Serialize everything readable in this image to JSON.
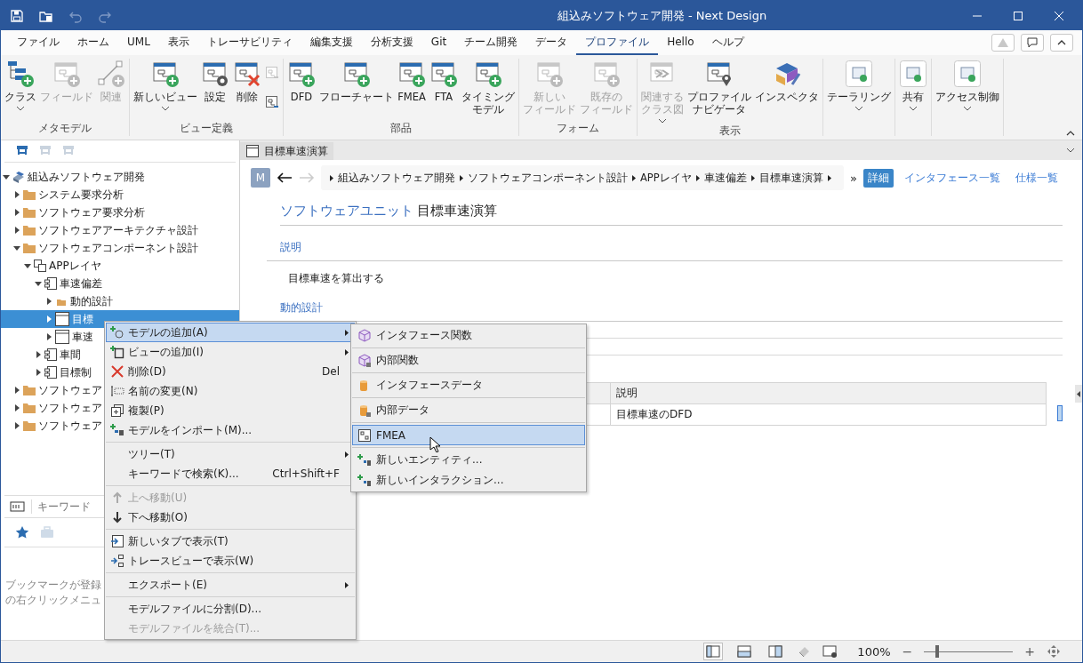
{
  "window": {
    "title": "組込みソフトウェア開発 - Next Design"
  },
  "menu_tabs": [
    {
      "label": "ファイル",
      "selected": false
    },
    {
      "label": "ホーム",
      "selected": false
    },
    {
      "label": "UML",
      "selected": false
    },
    {
      "label": "表示",
      "selected": false
    },
    {
      "label": "トレーサビリティ",
      "selected": false
    },
    {
      "label": "編集支援",
      "selected": false
    },
    {
      "label": "分析支援",
      "selected": false
    },
    {
      "label": "Git",
      "selected": false
    },
    {
      "label": "チーム開発",
      "selected": false
    },
    {
      "label": "データ",
      "selected": false
    },
    {
      "label": "プロファイル",
      "selected": true
    },
    {
      "label": "Hello",
      "selected": false
    },
    {
      "label": "ヘルプ",
      "selected": false
    }
  ],
  "ribbon": {
    "groups": [
      {
        "label": "メタモデル",
        "buttons": [
          {
            "lines": [
              "クラス"
            ],
            "dropdown": true,
            "disabled": false
          },
          {
            "lines": [
              "フィールド"
            ],
            "dropdown": false,
            "disabled": true
          },
          {
            "lines": [
              "関連"
            ],
            "dropdown": false,
            "disabled": true
          }
        ]
      },
      {
        "label": "ビュー定義",
        "buttons": [
          {
            "lines": [
              "新しいビュー"
            ],
            "dropdown": true,
            "disabled": false
          },
          {
            "lines": [
              "設定"
            ],
            "dropdown": false,
            "disabled": false
          },
          {
            "lines": [
              "削除"
            ],
            "dropdown": false,
            "disabled": false
          }
        ],
        "small_buttons": [
          {
            "disabled": true
          },
          {
            "disabled": false
          }
        ]
      },
      {
        "label": "部品",
        "buttons": [
          {
            "lines": [
              "DFD"
            ],
            "dropdown": false,
            "disabled": false
          },
          {
            "lines": [
              "フローチャート"
            ],
            "dropdown": false,
            "disabled": false
          },
          {
            "lines": [
              "FMEA"
            ],
            "dropdown": false,
            "disabled": false
          },
          {
            "lines": [
              "FTA"
            ],
            "dropdown": false,
            "disabled": false
          },
          {
            "lines": [
              "タイミング",
              "モデル"
            ],
            "dropdown": false,
            "disabled": false
          }
        ]
      },
      {
        "label": "フォーム",
        "buttons": [
          {
            "lines": [
              "新しい",
              "フィールド"
            ],
            "dropdown": false,
            "disabled": true
          },
          {
            "lines": [
              "既存の",
              "フィールド"
            ],
            "dropdown": false,
            "disabled": true
          }
        ]
      },
      {
        "label": "表示",
        "buttons": [
          {
            "lines": [
              "関連する",
              "クラス図"
            ],
            "dropdown": true,
            "disabled": true
          },
          {
            "lines": [
              "プロファイル",
              "ナビゲータ"
            ],
            "dropdown": false,
            "disabled": false
          },
          {
            "lines": [
              "インスペクタ"
            ],
            "dropdown": false,
            "disabled": false
          }
        ]
      },
      {
        "buttons": [
          {
            "lines": [
              "テーラリング"
            ],
            "dropdown": true,
            "disabled": false
          }
        ]
      },
      {
        "buttons": [
          {
            "lines": [
              "共有"
            ],
            "dropdown": true,
            "disabled": false
          }
        ]
      },
      {
        "buttons": [
          {
            "lines": [
              "アクセス制御"
            ],
            "dropdown": true,
            "disabled": false
          }
        ]
      }
    ]
  },
  "tree_toolbar": [
    {
      "disabled": false
    },
    {
      "disabled": true
    },
    {
      "disabled": true
    }
  ],
  "tree": {
    "items": [
      {
        "label": "組込みソフトウェア開発",
        "kind": "project",
        "expanded": true,
        "selected": false,
        "children": [
          {
            "label": "システム要求分析",
            "kind": "folder",
            "expanded": false,
            "selected": false
          },
          {
            "label": "ソフトウェア要求分析",
            "kind": "folder",
            "expanded": false,
            "selected": false
          },
          {
            "label": "ソフトウェアアーキテクチャ設計",
            "kind": "folder",
            "expanded": false,
            "selected": false
          },
          {
            "label": "ソフトウェアコンポーネント設計",
            "kind": "folder",
            "expanded": true,
            "selected": false,
            "children": [
              {
                "label": "APPレイヤ",
                "kind": "layer",
                "expanded": true,
                "selected": false,
                "children": [
                  {
                    "label": "車速偏差",
                    "kind": "component",
                    "expanded": true,
                    "selected": false,
                    "children": [
                      {
                        "label": "動的設計",
                        "kind": "subfolder",
                        "expanded": false,
                        "selected": false
                      },
                      {
                        "label": "目標",
                        "kind": "unit",
                        "expanded": false,
                        "selected": true
                      },
                      {
                        "label": "車速",
                        "kind": "unit",
                        "expanded": false,
                        "selected": false
                      }
                    ]
                  },
                  {
                    "label": "車間",
                    "kind": "component",
                    "expanded": false,
                    "selected": false
                  },
                  {
                    "label": "目標制",
                    "kind": "component",
                    "expanded": false,
                    "selected": false
                  }
                ]
              }
            ]
          },
          {
            "label": "ソフトウェア",
            "kind": "folder",
            "expanded": false,
            "selected": false
          },
          {
            "label": "ソフトウェア",
            "kind": "folder",
            "expanded": false,
            "selected": false
          },
          {
            "label": "ソフトウェア",
            "kind": "folder",
            "expanded": false,
            "selected": false
          }
        ]
      }
    ]
  },
  "search": {
    "placeholder": "キーワード"
  },
  "bookmark_hint": [
    "ブックマークが登録",
    "の右クリックメニュ"
  ],
  "editor_tab": {
    "label": "目標車速演算"
  },
  "nav": {
    "avatar": "M",
    "breadcrumb": [
      "組込みソフトウェア開発",
      "ソフトウェアコンポーネント設計",
      "APPレイヤ",
      "車速偏差",
      "目標車速演算"
    ],
    "more": "»"
  },
  "view_tabs": [
    {
      "label": "詳細",
      "selected": true
    },
    {
      "label": "インタフェース一覧",
      "selected": false
    },
    {
      "label": "仕様一覧",
      "selected": false
    }
  ],
  "heading": {
    "type": "ソフトウェアユニット",
    "name": "目標車速演算"
  },
  "sections": [
    {
      "title": "説明",
      "text": "目標車速を算出する"
    },
    {
      "title": "動的設計"
    }
  ],
  "table": {
    "columns": [
      "説明"
    ],
    "rows": [
      [
        "目標車速のDFD"
      ]
    ]
  },
  "context_menu": [
    {
      "kind": "item",
      "label": "モデルの追加(A)",
      "submenu": true,
      "disabled": false,
      "selected": true
    },
    {
      "kind": "item",
      "label": "ビューの追加(I)",
      "submenu": true,
      "disabled": false,
      "selected": false
    },
    {
      "kind": "item",
      "label": "削除(D)",
      "shortcut": "Del",
      "submenu": false,
      "disabled": false,
      "selected": false
    },
    {
      "kind": "item",
      "label": "名前の変更(N)",
      "submenu": false,
      "disabled": false,
      "selected": false
    },
    {
      "kind": "item",
      "label": "複製(P)",
      "submenu": false,
      "disabled": false,
      "selected": false
    },
    {
      "kind": "item",
      "label": "モデルをインポート(M)...",
      "submenu": false,
      "disabled": false,
      "selected": false
    },
    {
      "kind": "separator"
    },
    {
      "kind": "item",
      "label": "ツリー(T)",
      "submenu": true,
      "disabled": false,
      "selected": false
    },
    {
      "kind": "item",
      "label": "キーワードで検索(K)...",
      "shortcut": "Ctrl+Shift+F",
      "submenu": false,
      "disabled": false,
      "selected": false
    },
    {
      "kind": "separator"
    },
    {
      "kind": "item",
      "label": "上へ移動(U)",
      "submenu": false,
      "disabled": true,
      "selected": false
    },
    {
      "kind": "item",
      "label": "下へ移動(O)",
      "submenu": false,
      "disabled": false,
      "selected": false
    },
    {
      "kind": "separator"
    },
    {
      "kind": "item",
      "label": "新しいタブで表示(T)",
      "submenu": false,
      "disabled": false,
      "selected": false
    },
    {
      "kind": "item",
      "label": "トレースビューで表示(W)",
      "submenu": false,
      "disabled": false,
      "selected": false
    },
    {
      "kind": "separator"
    },
    {
      "kind": "item",
      "label": "エクスポート(E)",
      "submenu": true,
      "disabled": false,
      "selected": false
    },
    {
      "kind": "separator"
    },
    {
      "kind": "item",
      "label": "モデルファイルに分割(D)...",
      "submenu": false,
      "disabled": false,
      "selected": false
    },
    {
      "kind": "item",
      "label": "モデルファイルを統合(T)...",
      "submenu": false,
      "disabled": true,
      "selected": false
    }
  ],
  "submenu": [
    {
      "kind": "item",
      "label": "インタフェース関数",
      "selected": false
    },
    {
      "kind": "separator"
    },
    {
      "kind": "item",
      "label": "内部関数",
      "selected": false
    },
    {
      "kind": "separator"
    },
    {
      "kind": "item",
      "label": "インタフェースデータ",
      "selected": false
    },
    {
      "kind": "separator"
    },
    {
      "kind": "item",
      "label": "内部データ",
      "selected": false
    },
    {
      "kind": "separator"
    },
    {
      "kind": "item",
      "label": "FMEA",
      "selected": true
    },
    {
      "kind": "separator"
    },
    {
      "kind": "item",
      "label": "新しいエンティティ...",
      "selected": false
    },
    {
      "kind": "item",
      "label": "新しいインタラクション...",
      "selected": false
    }
  ],
  "status_bar": {
    "layout_buttons": [
      {
        "selected": true
      },
      {
        "selected": false
      },
      {
        "selected": false
      }
    ],
    "zoom_reading": "100%",
    "zoom_out": "−",
    "zoom_in": "+",
    "zoom_level": {
      "level": 0.13
    }
  }
}
